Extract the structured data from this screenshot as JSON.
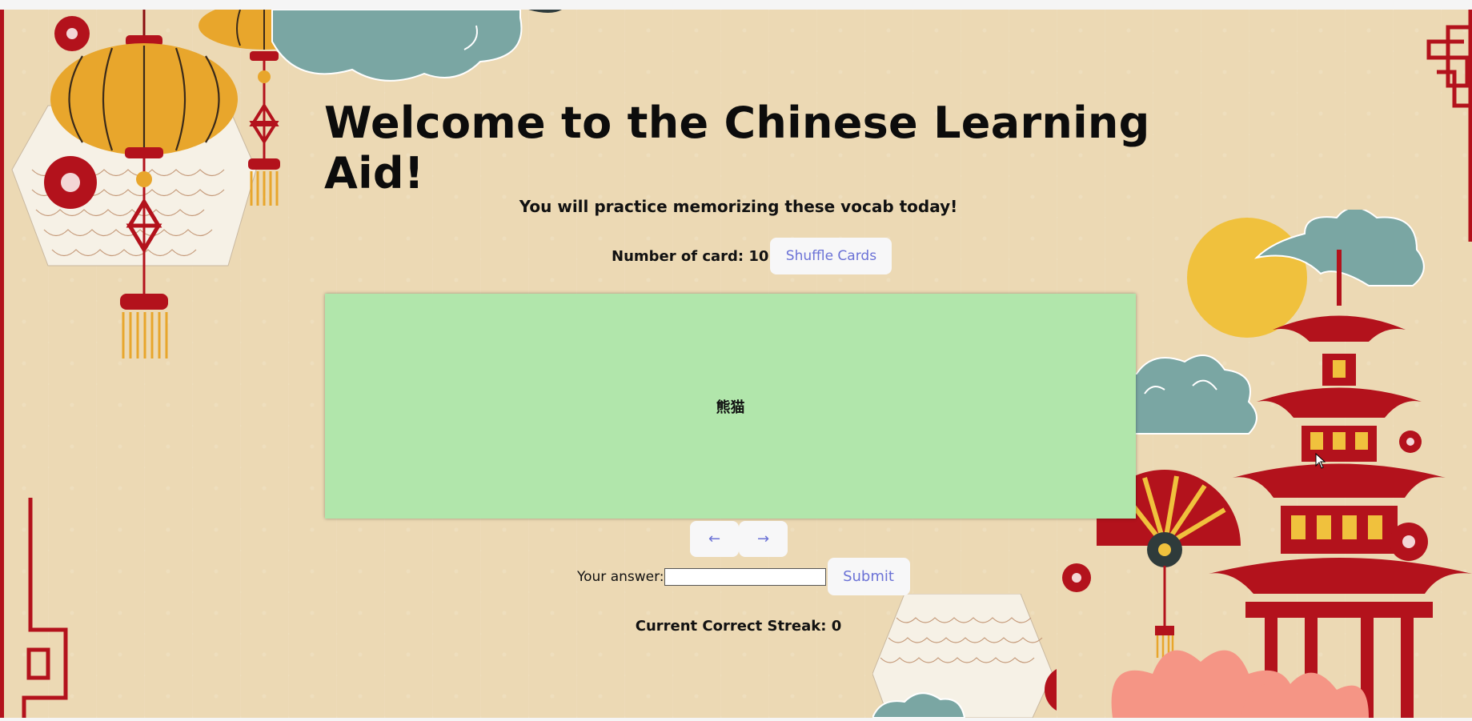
{
  "header": {
    "title": "Welcome to the Chinese Learning Aid!"
  },
  "intro": {
    "subtitle": "You will practice memorizing these vocab today!"
  },
  "deck": {
    "count_label": "Number of card: 10",
    "shuffle_label": "Shuffle Cards"
  },
  "card": {
    "text": "熊猫"
  },
  "navigation": {
    "prev_label": "←",
    "next_label": "→"
  },
  "answer": {
    "label": "Your answer:",
    "value": "",
    "submit_label": "Submit"
  },
  "streak": {
    "text": "Current Correct Streak: 0"
  },
  "colors": {
    "background": "#ecd9b4",
    "card": "#b1e6ab",
    "accent_red": "#b3121c",
    "lantern_gold": "#e8a62c",
    "cloud_teal": "#7aa6a3",
    "button_text": "#6b72d6"
  }
}
